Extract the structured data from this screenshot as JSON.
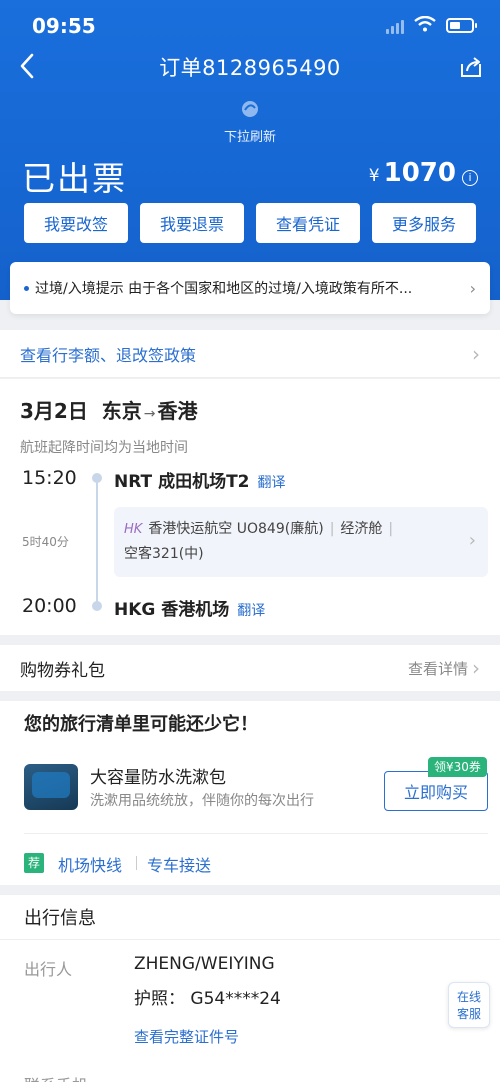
{
  "status_bar": {
    "time": "09:55"
  },
  "header": {
    "title": "订单8128965490",
    "refresh_hint": "下拉刷新",
    "ticket_status": "已出票",
    "currency": "¥",
    "price": "1070",
    "info_icon": "i",
    "actions": [
      "我要改签",
      "我要退票",
      "查看凭证",
      "更多服务"
    ]
  },
  "notice": {
    "text": "过境/入境提示  由于各个国家和地区的过境/入境政策有所不..."
  },
  "policy_link": "查看行李额、退改签政策",
  "flight": {
    "route_date": "3月2日",
    "from": "东京",
    "to": "香港",
    "arrow": "→",
    "time_note": "航班起降时间均为当地时间",
    "dep_time": "15:20",
    "dep_airport": "NRT 成田机场T2",
    "arr_time": "20:00",
    "arr_airport": "HKG 香港机场",
    "translate": "翻译",
    "duration": "5时40分",
    "airline_logo": "HK",
    "airline": "香港快运航空 UO849(廉航)",
    "cabin": "经济舱",
    "aircraft": "空客321(中)"
  },
  "coupon": {
    "label": "购物券礼包",
    "more": "查看详情"
  },
  "recommend": {
    "title": "您的旅行清单里可能还少它！",
    "product_name": "大容量防水洗漱包",
    "product_desc": "洗漱用品统统放，伴随你的每次出行",
    "badge": "领¥30券",
    "buy": "立即购买",
    "tag": "荐",
    "link1": "机场快线",
    "link2": "专车接送"
  },
  "travel": {
    "title": "出行信息",
    "pax_label": "出行人",
    "pax_name": "ZHENG/WEIYING",
    "passport": "护照：  G54****24",
    "full_id": "查看完整证件号",
    "next_label": "联系手机"
  },
  "chat": {
    "line1": "在线",
    "line2": "客服"
  },
  "colors": {
    "header_blue": "#1a6fdc",
    "link_blue": "#2b6fd0",
    "green": "#2ab37a"
  }
}
